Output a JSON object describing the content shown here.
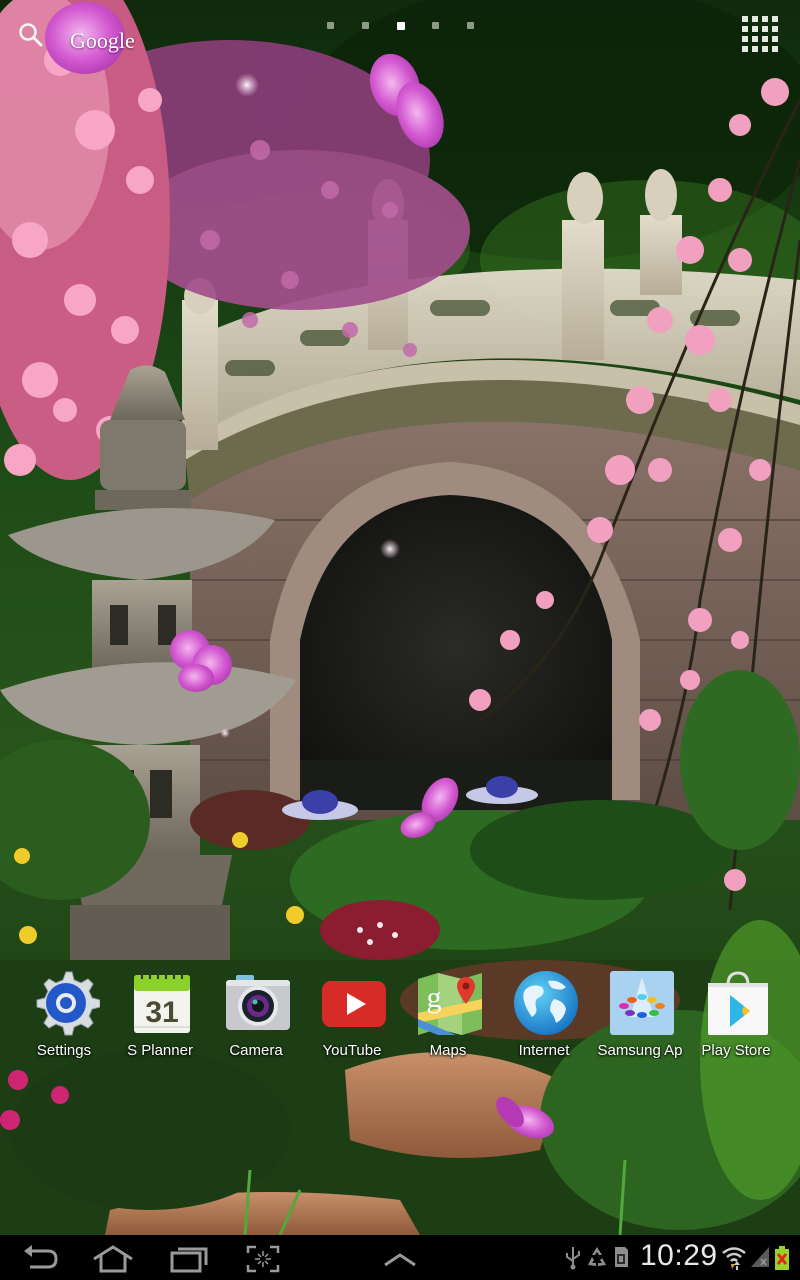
{
  "screen": "Android home screen",
  "top_bar": {
    "search_icon": "search-icon",
    "search_label": "Google",
    "page_count": 5,
    "active_page": 3,
    "apps_icon": "apps-grid-icon"
  },
  "dock": {
    "apps": [
      {
        "label": "Settings",
        "icon": "settings-gear-icon"
      },
      {
        "label": "S Planner",
        "icon": "calendar-icon",
        "icon_text": "31"
      },
      {
        "label": "Camera",
        "icon": "camera-icon"
      },
      {
        "label": "YouTube",
        "icon": "youtube-icon"
      },
      {
        "label": "Maps",
        "icon": "maps-icon"
      },
      {
        "label": "Internet",
        "icon": "globe-icon"
      },
      {
        "label": "Samsung Ap",
        "icon": "samsung-apps-icon"
      },
      {
        "label": "Play Store",
        "icon": "play-store-icon"
      }
    ]
  },
  "system_bar": {
    "nav": [
      {
        "name": "back-button",
        "icon": "back-icon"
      },
      {
        "name": "home-button",
        "icon": "home-icon"
      },
      {
        "name": "recent-apps-button",
        "icon": "recent-apps-icon"
      },
      {
        "name": "screenshot-button",
        "icon": "screenshot-icon"
      },
      {
        "name": "mini-apps-tray-button",
        "icon": "chevron-up-icon"
      }
    ],
    "status": {
      "clock": "10:29",
      "icons": [
        "usb-icon",
        "recycle-icon",
        "sd-card-icon",
        "wifi-icon",
        "cell-signal-icon",
        "battery-icon"
      ],
      "battery_state": "not-charging",
      "signal": "no-signal"
    }
  },
  "colors": {
    "system_bar_bg": "#000000",
    "label_text": "#ffffff",
    "youtube_red": "#d62b26",
    "settings_blue": "#2358c9",
    "planner_green": "#8bd12a",
    "wifi_arrow_orange": "#f0a020",
    "battery_red": "#e0281c",
    "battery_green": "#9ad12a"
  },
  "wallpaper": {
    "description": "Japanese garden live wallpaper: stone arched bridge, stone lantern, cherry blossoms, butterflies, lotus flowers"
  }
}
